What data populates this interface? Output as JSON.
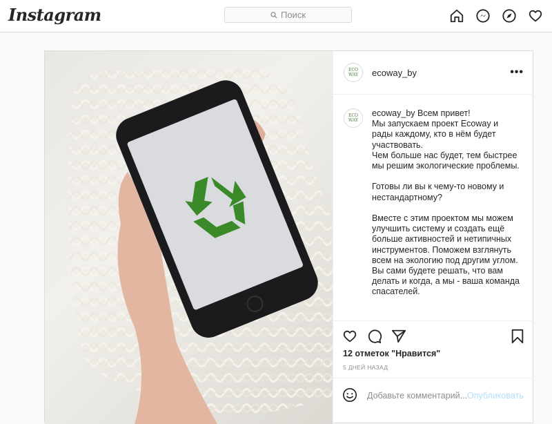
{
  "app": {
    "logo": "Instagram"
  },
  "search": {
    "placeholder": "Поиск"
  },
  "nav": {
    "icons": [
      "home-icon",
      "direct-messenger-icon",
      "explore-compass-icon",
      "activity-heart-icon"
    ]
  },
  "post": {
    "username": "ecoway_by",
    "avatar_text_line1": "ECO",
    "avatar_text_line2": "WAY",
    "caption_username": "ecoway_by",
    "caption_text": " Всем привет!\nМы запускаем проект Ecoway и рады каждому, кто в нём будет участвовать.\nЧем больше нас будет, тем быстрее мы решим экологические проблемы.\n\nГотовы ли вы к чему-то новому и нестандартному?\n\nВместе с этим проектом мы можем улучшить систему и создать ещё больше активностей и нетипичных инструментов. Поможем взглянуть всем на экологию под другим углом. Вы сами будете решать, что вам делать и когда, а мы - ваша команда спасателей.",
    "likes": "12 отметок \"Нравится\"",
    "date": "5 ДНЕЙ НАЗАД",
    "comment_placeholder": "Добавьте комментарий...",
    "publish_label": "Опубликовать",
    "more_label": "•••"
  },
  "colors": {
    "accent_blue_disabled": "#b2dffc",
    "recycle_green": "#3a8a2a",
    "border": "#dbdbdb"
  }
}
